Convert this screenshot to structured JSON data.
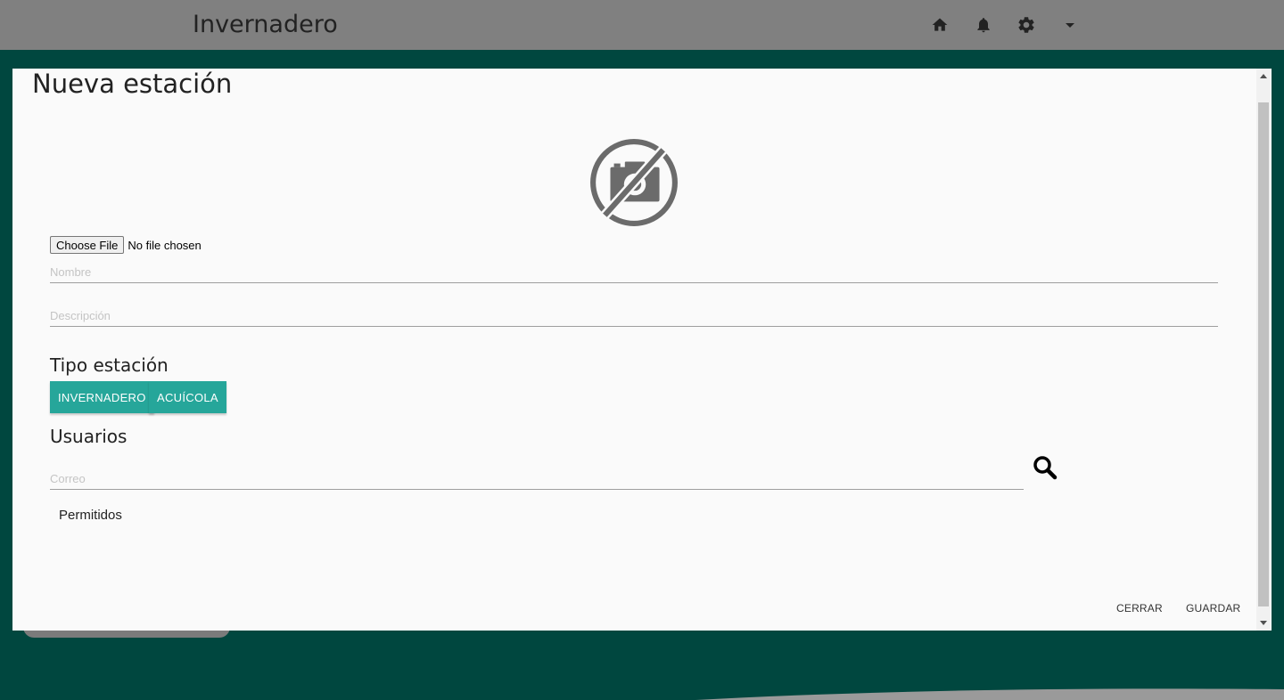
{
  "header": {
    "app_title": "Invernadero",
    "icons": [
      "home-icon",
      "bell-icon",
      "gear-icon",
      "caret-down-icon"
    ]
  },
  "modal": {
    "title": "Nueva estación",
    "photo_icon": "no-camera-icon",
    "file": {
      "button_label": "Choose File",
      "status": "No file chosen"
    },
    "nombre": {
      "placeholder": "Nombre",
      "value": ""
    },
    "descripcion": {
      "placeholder": "Descripción",
      "value": ""
    },
    "tipo_label": "Tipo estación",
    "tipo_buttons": [
      "INVERNADERO",
      "ACUÍCOLA"
    ],
    "usuarios_label": "Usuarios",
    "correo": {
      "placeholder": "Correo",
      "value": ""
    },
    "permitidos_label": "Permitidos",
    "footer": {
      "close_label": "CERRAR",
      "save_label": "GUARDAR"
    }
  },
  "colors": {
    "accent": "#26a69a",
    "background": "#00473f",
    "header": "#808080"
  }
}
